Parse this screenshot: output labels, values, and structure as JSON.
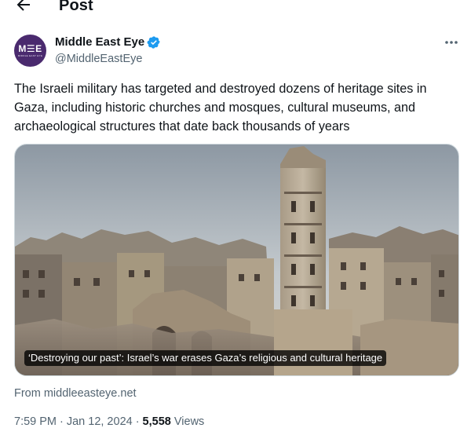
{
  "header": {
    "title": "Post"
  },
  "author": {
    "display_name": "Middle East Eye",
    "handle": "@MiddleEastEye",
    "avatar_mark": "M☰E",
    "avatar_sub": "MIDDLE EAST EYE",
    "verified_color": "#1d9bf0",
    "avatar_color": "#4a2a6e"
  },
  "tweet": {
    "text": "The Israeli military has targeted and destroyed dozens of heritage sites in Gaza, including historic churches and mosques, cultural museums, and archaeological structures that date back thousands of years"
  },
  "card": {
    "caption": "‘Destroying our past’: Israel’s war erases Gaza’s religious and cultural heritage",
    "source": "From middleeasteye.net"
  },
  "meta": {
    "time": "7:59 PM",
    "date": "Jan 12, 2024",
    "views_count": "5,558",
    "views_label": "Views"
  },
  "icons": {
    "back": "arrow-left-icon",
    "more": "more-horizontal-icon",
    "verified": "verified-badge-icon"
  }
}
